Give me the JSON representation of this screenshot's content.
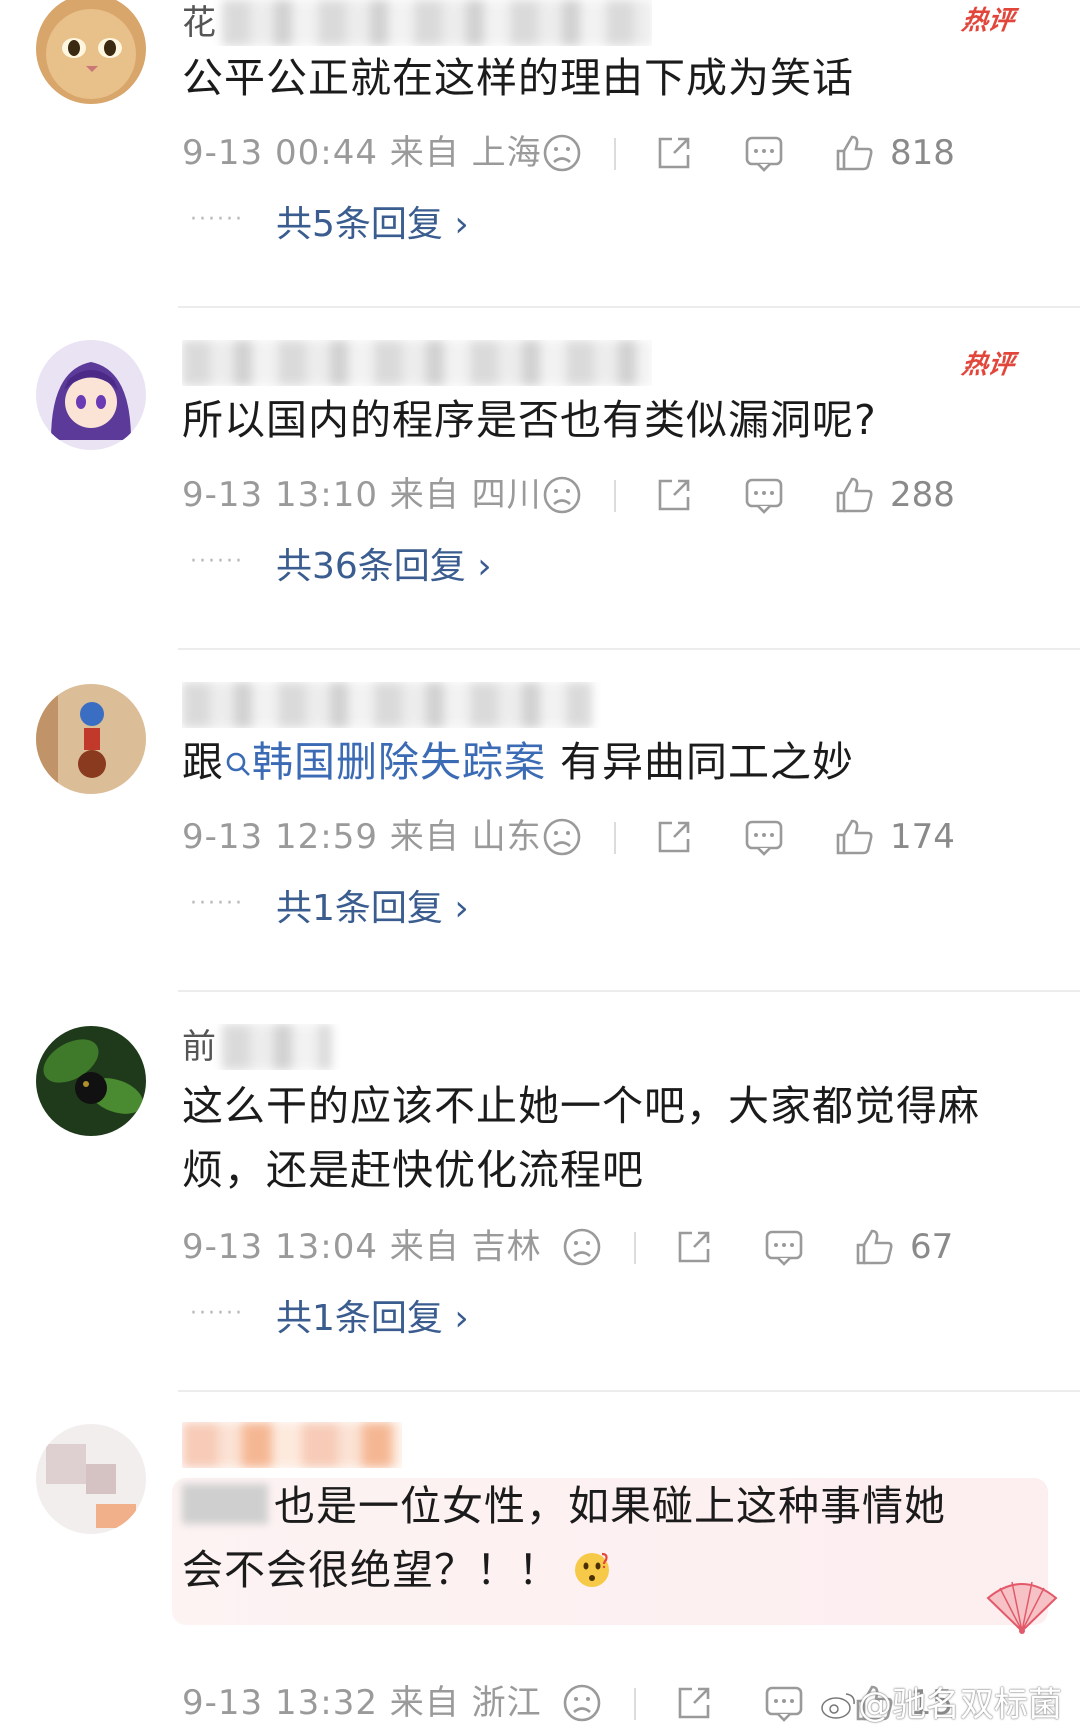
{
  "colors": {
    "hot_badge": "#e2463a",
    "link": "#3b6bb5",
    "replies_link": "#3a5c8f",
    "meta_text": "#9a9a9a"
  },
  "icons": {
    "dislike": "frown-face-icon",
    "repost": "share-icon",
    "comment": "comment-bubble-icon",
    "like": "thumbs-up-icon",
    "chevron": "chevron-right-icon"
  },
  "comments": [
    {
      "username": "花",
      "hot_badge": "热评",
      "text": "公平公正就在这样的理由下成为笑话",
      "timestamp": "9-13 00:44 来自 上海",
      "likes": "818",
      "replies": "共5条回复 ›"
    },
    {
      "username": "",
      "hot_badge": "热评",
      "text": "所以国内的程序是否也有类似漏洞呢?",
      "timestamp": "9-13 13:10 来自 四川",
      "likes": "288",
      "replies": "共36条回复 ›"
    },
    {
      "username": "",
      "text_prefix": "跟",
      "link_text": "韩国删除失踪案",
      "text_suffix": " 有异曲同工之妙",
      "timestamp": "9-13 12:59 来自 山东",
      "likes": "174",
      "replies": "共1条回复 ›"
    },
    {
      "username": "前",
      "text_line1": "这么干的应该不止她一个吧，大家都觉得麻",
      "text_line2": "烦，还是赶快优化流程吧",
      "timestamp": "9-13 13:04 来自 吉林",
      "likes": "67",
      "replies": "共1条回复 ›"
    },
    {
      "username": "",
      "text_line1": "也是一位女性，如果碰上这种事情她",
      "text_line2": "会不会很绝望？！！",
      "emoji": "thinking-face-emoji",
      "timestamp": "9-13 13:32 来自 浙江",
      "likes": "15"
    }
  ],
  "watermark": "@驰名双标菌"
}
